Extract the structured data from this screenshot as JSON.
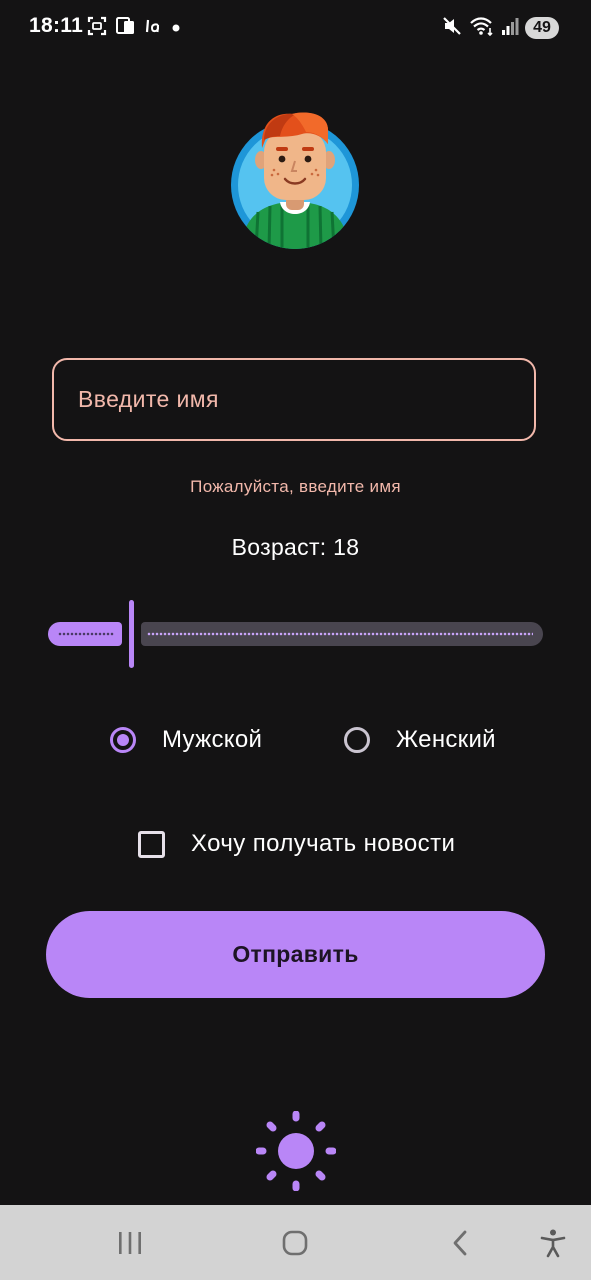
{
  "status_bar": {
    "time": "18:11",
    "battery": "49",
    "icons": [
      "screenshot-icon",
      "cast-icon",
      "app-notification-icon",
      "notification-dot-icon",
      "mute-icon",
      "wifi-icon",
      "signal-icon"
    ]
  },
  "avatar": {
    "icon": "avatar-icon"
  },
  "form": {
    "name_placeholder": "Введите имя",
    "name_value": "",
    "name_error": "Пожалуйста, введите имя",
    "age_label": "Возраст: 18",
    "age_value": 18,
    "age_fraction": 0.14,
    "gender_options": [
      {
        "label": "Мужской",
        "selected": true
      },
      {
        "label": "Женский",
        "selected": false
      }
    ],
    "newsletter_label": "Хочу получать новости",
    "newsletter_checked": false,
    "submit_label": "Отправить"
  },
  "theme_toggle": {
    "icon": "sun-icon"
  },
  "nav": {
    "icons": [
      "recent-apps-icon",
      "home-icon",
      "back-icon",
      "accessibility-icon"
    ]
  },
  "colors": {
    "background": "#141314",
    "accent": "#b986f7",
    "error": "#f2b8ab",
    "track_inactive": "#49454f",
    "nav_background": "#d3d3d3"
  }
}
